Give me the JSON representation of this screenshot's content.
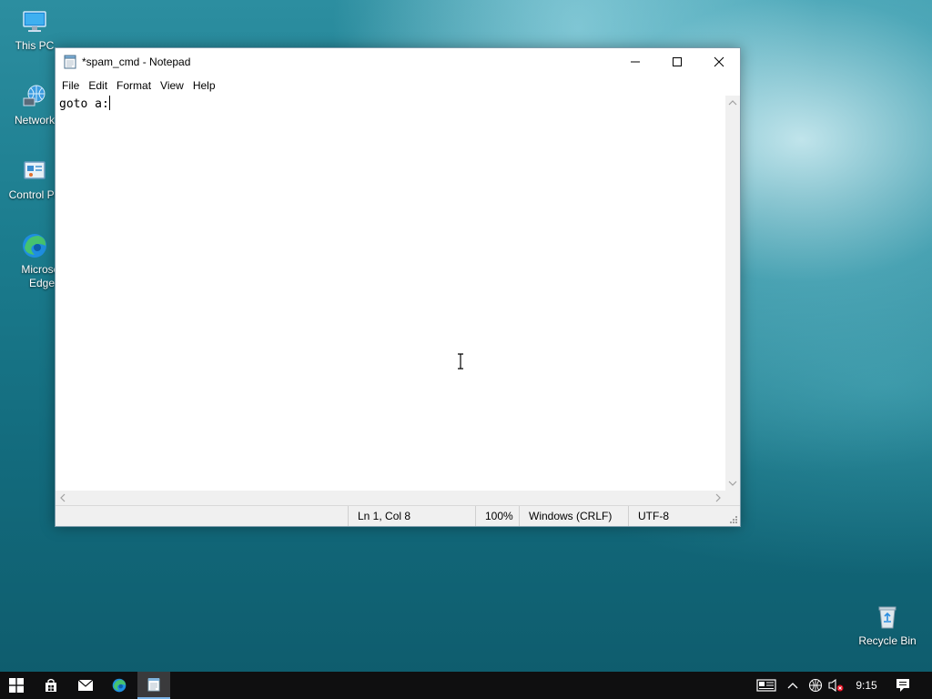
{
  "desktop": {
    "icons": [
      {
        "label": "This PC"
      },
      {
        "label": "Network"
      },
      {
        "label": "Control Pa"
      },
      {
        "label": "Microsof Edge"
      },
      {
        "label": "Recycle Bin"
      }
    ]
  },
  "window": {
    "title": "*spam_cmd - Notepad",
    "menu": [
      "File",
      "Edit",
      "Format",
      "View",
      "Help"
    ],
    "content": "goto a:",
    "status": {
      "position": "Ln 1, Col 8",
      "zoom": "100%",
      "line_endings": "Windows (CRLF)",
      "encoding": "UTF-8"
    }
  },
  "taskbar": {
    "time": "9:15"
  },
  "colors": {
    "taskbar_bg": "#0f0f10",
    "accent": "#0078d7"
  }
}
